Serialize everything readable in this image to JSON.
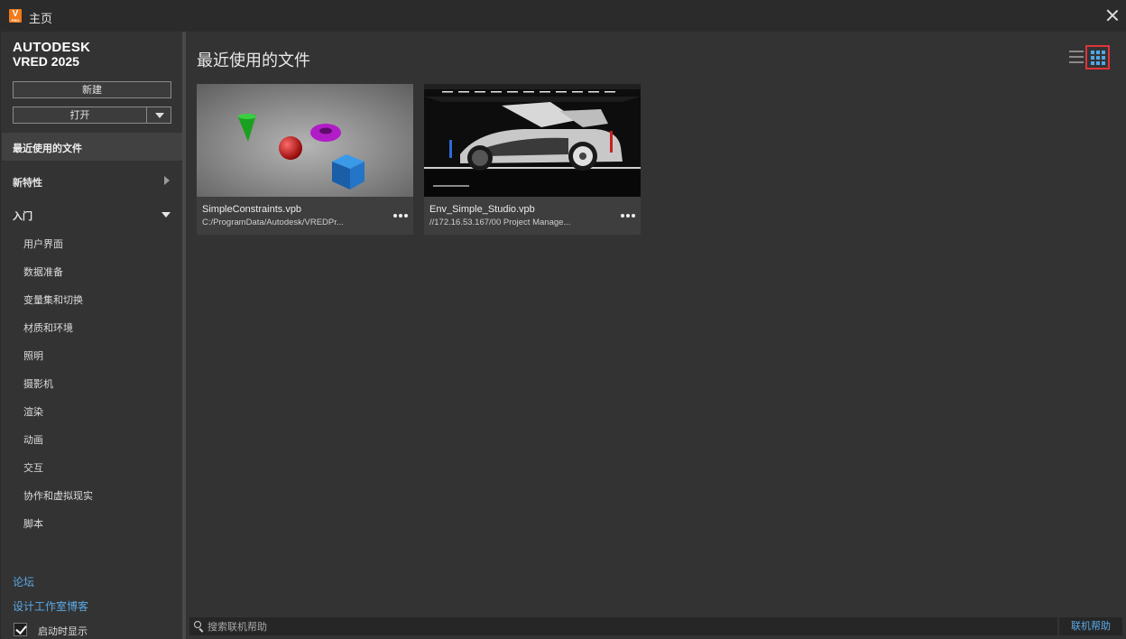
{
  "window": {
    "title": "主页",
    "app_icon": "vred-app-icon"
  },
  "brand": {
    "line1": "AUTODESK",
    "line2": "VRED 2025"
  },
  "sidebar": {
    "new_label": "新建",
    "open_label": "打开",
    "recent_label": "最近使用的文件",
    "whats_new_label": "新特性",
    "getting_started_label": "入门",
    "getting_started_items": [
      "用户界面",
      "数据准备",
      "变量集和切换",
      "材质和环境",
      "照明",
      "摄影机",
      "渲染",
      "动画",
      "交互",
      "协作和虚拟现实",
      "脚本"
    ],
    "forum_label": "论坛",
    "blog_label": "设计工作室博客",
    "show_on_startup_label": "启动时显示",
    "show_on_startup_checked": true
  },
  "main": {
    "title": "最近使用的文件",
    "view_mode": "grid",
    "files": [
      {
        "name": "SimpleConstraints.vpb",
        "path": "C:/ProgramData/Autodesk/VREDPr..."
      },
      {
        "name": "Env_Simple_Studio.vpb",
        "path": "//172.16.53.167/00 Project Manage..."
      }
    ]
  },
  "footer": {
    "search_placeholder": "搜索联机帮助",
    "search_value": "",
    "online_help_label": "联机帮助"
  },
  "colors": {
    "accent": "#5aa9e6",
    "highlight_box": "#e0343a",
    "brand_orange": "#f07a1a"
  }
}
